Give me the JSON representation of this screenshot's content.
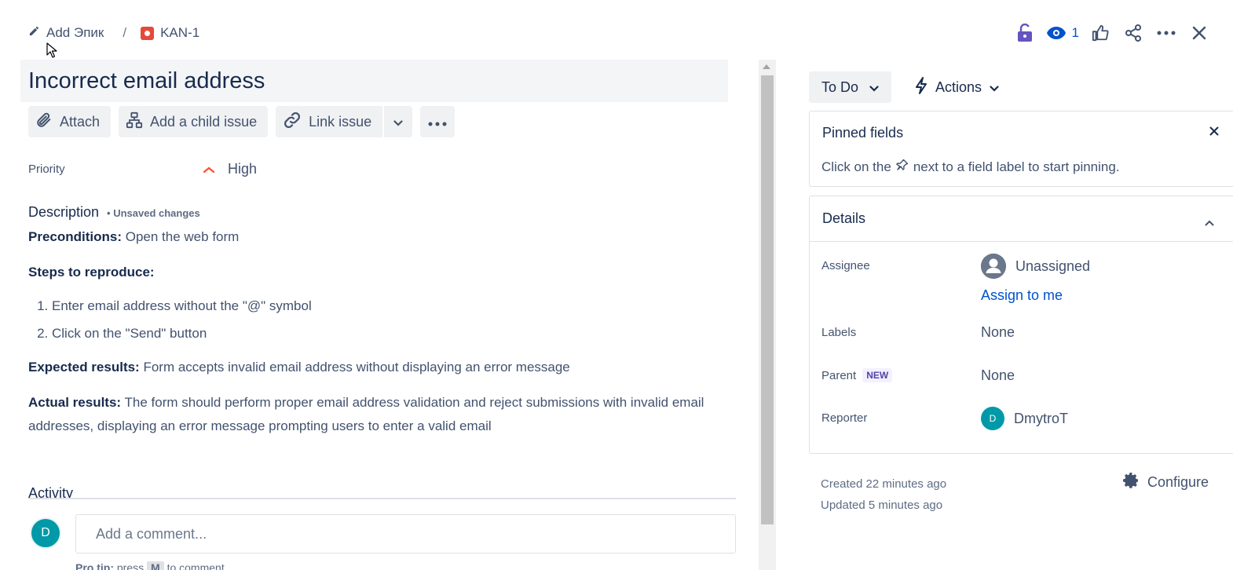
{
  "breadcrumb": {
    "add_epic": "Add Эпик",
    "separator": "/",
    "issue_key": "KAN-1"
  },
  "top_actions": {
    "watch_count": "1"
  },
  "issue": {
    "title": "Incorrect email address"
  },
  "toolbar": {
    "attach": "Attach",
    "add_child": "Add a child issue",
    "link_issue": "Link issue"
  },
  "priority": {
    "label": "Priority",
    "value": "High"
  },
  "description": {
    "heading": "Description",
    "unsaved": "• Unsaved changes",
    "preconditions_label": "Preconditions:",
    "preconditions_text": " Open the web form",
    "steps_label": "Steps to reproduce:",
    "steps": [
      "Enter email address without the \"@\" symbol",
      "Click on the \"Send\" button"
    ],
    "expected_label": "Expected results:",
    "expected_text": " Form accepts invalid email address without displaying an error message",
    "actual_label": "Actual results:",
    "actual_text": " The form should perform proper email address validation and reject submissions with invalid email addresses, displaying an error message prompting users to enter a valid email"
  },
  "activity": {
    "heading": "Activity",
    "avatar_initial": "D",
    "comment_placeholder": "Add a comment...",
    "pro_tip_prefix": "Pro tip:",
    "pro_tip_press": " press ",
    "pro_tip_key": "M",
    "pro_tip_suffix": " to comment"
  },
  "status": {
    "current": "To Do",
    "actions": "Actions"
  },
  "pinned": {
    "heading": "Pinned fields",
    "hint_before": "Click on the",
    "hint_after": "next to a field label to start pinning."
  },
  "details": {
    "heading": "Details",
    "assignee_label": "Assignee",
    "assignee_value": "Unassigned",
    "assign_to_me": "Assign to me",
    "labels_label": "Labels",
    "labels_value": "None",
    "parent_label": "Parent",
    "parent_badge": "NEW",
    "parent_value": "None",
    "reporter_label": "Reporter",
    "reporter_initial": "D",
    "reporter_value": "DmytroT"
  },
  "meta": {
    "created": "Created 22 minutes ago",
    "updated": "Updated 5 minutes ago",
    "configure": "Configure"
  },
  "colors": {
    "accent": "#0052cc",
    "bug": "#e5493a",
    "priority_high": "#ff5630",
    "avatar": "#0099a8",
    "lock": "#6554c0"
  }
}
